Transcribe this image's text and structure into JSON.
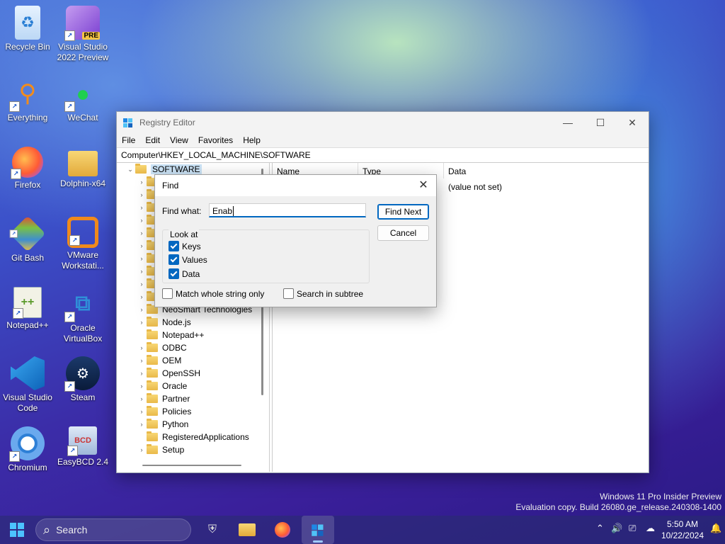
{
  "desktop": {
    "icons": [
      {
        "label": "Recycle Bin"
      },
      {
        "label": "Visual Studio 2022 Preview",
        "badge": "PRE"
      },
      {
        "label": "Everything"
      },
      {
        "label": "WeChat"
      },
      {
        "label": "Firefox"
      },
      {
        "label": "Dolphin-x64"
      },
      {
        "label": "Git Bash"
      },
      {
        "label": "VMware Workstati..."
      },
      {
        "label": "Notepad++"
      },
      {
        "label": "Oracle VirtualBox"
      },
      {
        "label": "Visual Studio Code"
      },
      {
        "label": "Steam"
      },
      {
        "label": "Chromium"
      },
      {
        "label": "EasyBCD 2.4"
      }
    ]
  },
  "regedit": {
    "title": "Registry Editor",
    "menu": [
      "File",
      "Edit",
      "View",
      "Favorites",
      "Help"
    ],
    "address": "Computer\\HKEY_LOCAL_MACHINE\\SOFTWARE",
    "tree": {
      "root": "SOFTWARE",
      "items": [
        "NeoSmart Technologies",
        "Node.js",
        "Notepad++",
        "ODBC",
        "OEM",
        "OpenSSH",
        "Oracle",
        "Partner",
        "Policies",
        "Python",
        "RegisteredApplications",
        "Setup"
      ]
    },
    "columns": [
      "Name",
      "Type",
      "Data"
    ],
    "row_data": "(value not set)"
  },
  "find_dialog": {
    "title": "Find",
    "find_what_label": "Find what:",
    "find_what_value": "Enab",
    "find_next": "Find Next",
    "cancel": "Cancel",
    "look_at_label": "Look at",
    "keys": "Keys",
    "values": "Values",
    "data": "Data",
    "match_whole": "Match whole string only",
    "search_subtree": "Search in subtree"
  },
  "taskbar": {
    "search_placeholder": "Search",
    "time": "5:50 AM",
    "date": "10/22/2024"
  },
  "watermark": {
    "line1": "Windows 11 Pro Insider Preview",
    "line2": "Evaluation copy. Build 26080.ge_release.240308-1400"
  }
}
